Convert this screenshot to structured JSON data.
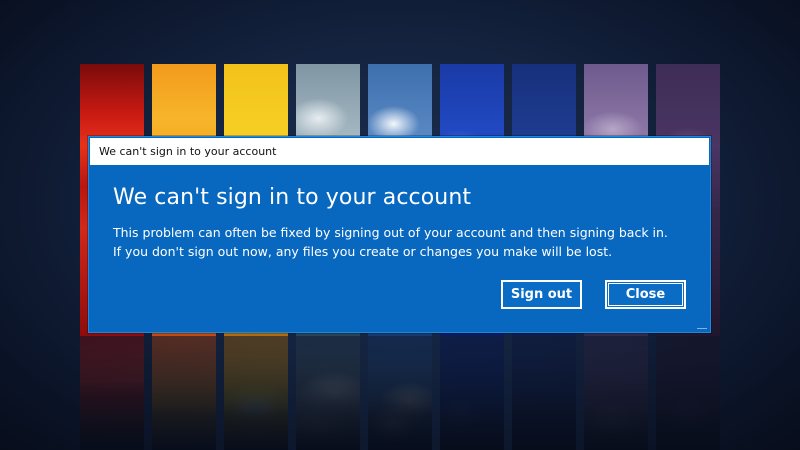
{
  "window": {
    "title": "We can't sign in to your account"
  },
  "dialog": {
    "heading": "We can't sign in to your account",
    "message_line_1": "This problem can often be fixed by signing out of your account and then signing back in.",
    "message_line_2": "If you don't sign out now, any files you create or changes you make will be lost."
  },
  "buttons": {
    "sign_out_label": "Sign out",
    "close_label": "Close"
  },
  "colors": {
    "dialog_background": "#0868bf",
    "titlebar_background": "#ffffff",
    "text": "#ffffff"
  }
}
